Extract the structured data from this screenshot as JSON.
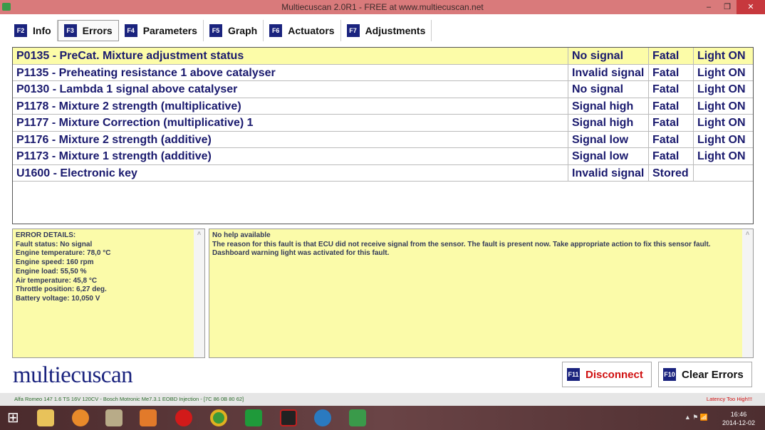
{
  "window": {
    "title": "Multiecuscan 2.0R1 - FREE at www.multiecuscan.net",
    "min": "–",
    "restore": "❐",
    "close": "✕"
  },
  "tabs": [
    {
      "key": "F2",
      "label": "Info"
    },
    {
      "key": "F3",
      "label": "Errors"
    },
    {
      "key": "F4",
      "label": "Parameters"
    },
    {
      "key": "F5",
      "label": "Graph"
    },
    {
      "key": "F6",
      "label": "Actuators"
    },
    {
      "key": "F7",
      "label": "Adjustments"
    }
  ],
  "errors": [
    {
      "code": "P0135 - PreCat. Mixture adjustment status",
      "status": "No signal",
      "type": "Fatal",
      "light": "Light ON"
    },
    {
      "code": "P1135 - Preheating resistance 1 above catalyser",
      "status": "Invalid signal",
      "type": "Fatal",
      "light": "Light ON"
    },
    {
      "code": "P0130 - Lambda 1 signal above catalyser",
      "status": "No signal",
      "type": "Fatal",
      "light": "Light ON"
    },
    {
      "code": "P1178 - Mixture 2 strength  (multiplicative)",
      "status": "Signal high",
      "type": "Fatal",
      "light": "Light ON"
    },
    {
      "code": "P1177 - Mixture Correction (multiplicative) 1",
      "status": "Signal high",
      "type": "Fatal",
      "light": "Light ON"
    },
    {
      "code": "P1176 - Mixture 2 strength (additive)",
      "status": "Signal low",
      "type": "Fatal",
      "light": "Light ON"
    },
    {
      "code": "P1173 - Mixture 1 strength (additive)",
      "status": "Signal low",
      "type": "Fatal",
      "light": "Light ON"
    },
    {
      "code": "U1600 - Electronic key",
      "status": "Invalid signal",
      "type": "Stored",
      "light": ""
    }
  ],
  "details": [
    "ERROR DETAILS:",
    "Fault status: No signal",
    "Engine temperature: 78,0 °C",
    "Engine speed: 160 rpm",
    "Engine load: 55,50 %",
    "Air temperature: 45,8 °C",
    "Throttle position: 6,27 deg.",
    "Battery voltage: 10,050 V"
  ],
  "help": [
    "No help available",
    "The reason for this fault is that ECU did not receive signal from the sensor. The fault is present now. Take appropriate action to fix this sensor fault.",
    "Dashboard warning light was activated for this fault."
  ],
  "logo": "multiecuscan",
  "buttons": {
    "disconnect_key": "F11",
    "disconnect": "Disconnect",
    "clear_key": "F10",
    "clear": "Clear Errors"
  },
  "status": {
    "vehicle": "Alfa Romeo 147 1.6 TS 16V 120CV - Bosch Motronic Me7.3.1 EOBD Injection - [7C 86 0B 80 62]",
    "latency": "Latency Too High!!!"
  },
  "clock": {
    "time": "16:46",
    "date": "2014-12-02"
  }
}
